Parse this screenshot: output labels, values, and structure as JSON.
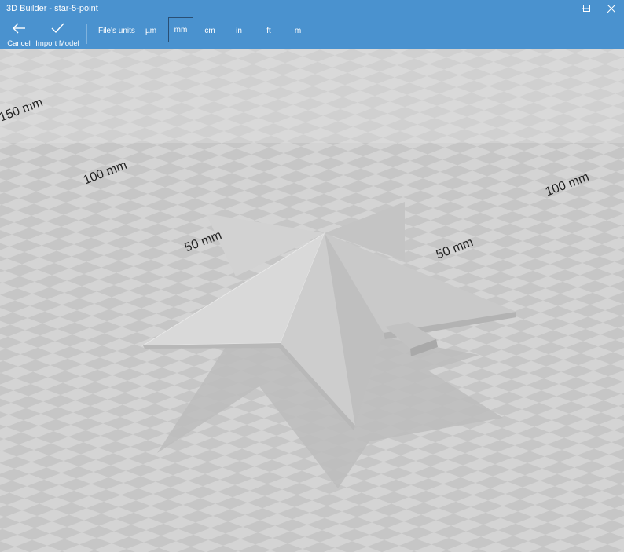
{
  "window": {
    "title": "3D Builder - star-5-point",
    "minimize_icon": "minimize-icon",
    "maximize_icon": "maximize-icon",
    "close_icon": "close-icon"
  },
  "toolbar": {
    "cancel_label": "Cancel",
    "import_label": "Import Model",
    "units_label": "File's units",
    "units": [
      "µm",
      "mm",
      "cm",
      "in",
      "ft",
      "m"
    ],
    "selected_unit": "mm"
  },
  "viewport": {
    "axis_labels_left": [
      "150 mm",
      "100 mm",
      "50 mm"
    ],
    "axis_labels_right": [
      "100 mm",
      "50 mm"
    ],
    "model": "star-5-point"
  },
  "colors": {
    "accent": "#4a92cf",
    "floor_light": "#d4d4d4",
    "floor_dark": "#c4c4c4"
  }
}
